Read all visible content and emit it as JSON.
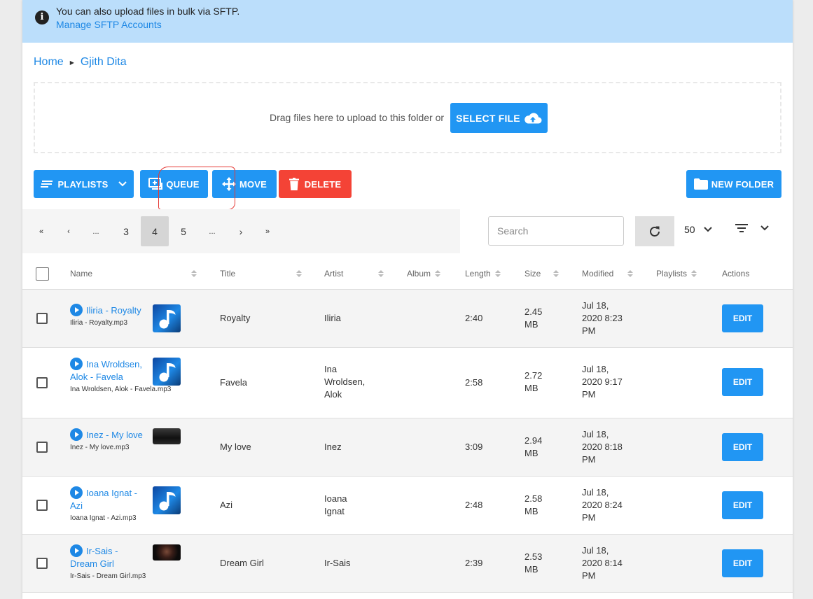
{
  "banner": {
    "text": "You can also upload files in bulk via SFTP.",
    "link": "Manage SFTP Accounts",
    "icon": "info-icon"
  },
  "breadcrumb": {
    "home": "Home",
    "current": "Gjith Dita"
  },
  "upload": {
    "prompt": "Drag files here to upload to this folder or",
    "button": "SELECT FILE"
  },
  "toolbar": {
    "playlists": "PLAYLISTS",
    "queue": "QUEUE",
    "move": "MOVE",
    "delete": "DELETE",
    "new_folder": "NEW FOLDER"
  },
  "pagination": {
    "first": "«",
    "prev": "‹",
    "ellipsis_left": "...",
    "pages": [
      "3",
      "4",
      "5"
    ],
    "active_page": "4",
    "ellipsis_right": "...",
    "next": "›",
    "last": "»"
  },
  "search": {
    "placeholder": "Search",
    "value": ""
  },
  "per_page": "50",
  "columns": {
    "name": "Name",
    "title": "Title",
    "artist": "Artist",
    "album": "Album",
    "length": "Length",
    "size": "Size",
    "modified": "Modified",
    "playlists": "Playlists",
    "actions": "Actions"
  },
  "rows": [
    {
      "name": "Iliria - Royalty",
      "filename": "Iliria - Royalty.mp3",
      "title": "Royalty",
      "artist": "Iliria",
      "album": "",
      "length": "2:40",
      "size": "2.45 MB",
      "modified": "Jul 18, 2020 8:23 PM",
      "edit": "EDIT",
      "thumb": "music-note"
    },
    {
      "name": "Ina Wroldsen, Alok - Favela",
      "filename": "Ina Wroldsen, Alok - Favela.mp3",
      "title": "Favela",
      "artist": "Ina Wroldsen, Alok",
      "album": "",
      "length": "2:58",
      "size": "2.72 MB",
      "modified": "Jul 18, 2020 9:17 PM",
      "edit": "EDIT",
      "thumb": "music-note"
    },
    {
      "name": "Inez - My love",
      "filename": "Inez - My love.mp3",
      "title": "My love",
      "artist": "Inez",
      "album": "",
      "length": "3:09",
      "size": "2.94 MB",
      "modified": "Jul 18, 2020 8:18 PM",
      "edit": "EDIT",
      "thumb": "album-art-photo"
    },
    {
      "name": "Ioana Ignat - Azi",
      "filename": "Ioana Ignat - Azi.mp3",
      "title": "Azi",
      "artist": "Ioana Ignat",
      "album": "",
      "length": "2:48",
      "size": "2.58 MB",
      "modified": "Jul 18, 2020 8:24 PM",
      "edit": "EDIT",
      "thumb": "music-note"
    },
    {
      "name": "Ir-Sais - Dream Girl",
      "filename": "Ir-Sais - Dream Girl.mp3",
      "title": "Dream Girl",
      "artist": "Ir-Sais",
      "album": "",
      "length": "2:39",
      "size": "2.53 MB",
      "modified": "Jul 18, 2020 8:14 PM",
      "edit": "EDIT",
      "thumb": "album-art-photo"
    }
  ],
  "colors": {
    "primary": "#2196f3",
    "danger": "#f44336",
    "banner": "#bbdefb",
    "link": "#1e88e5"
  }
}
